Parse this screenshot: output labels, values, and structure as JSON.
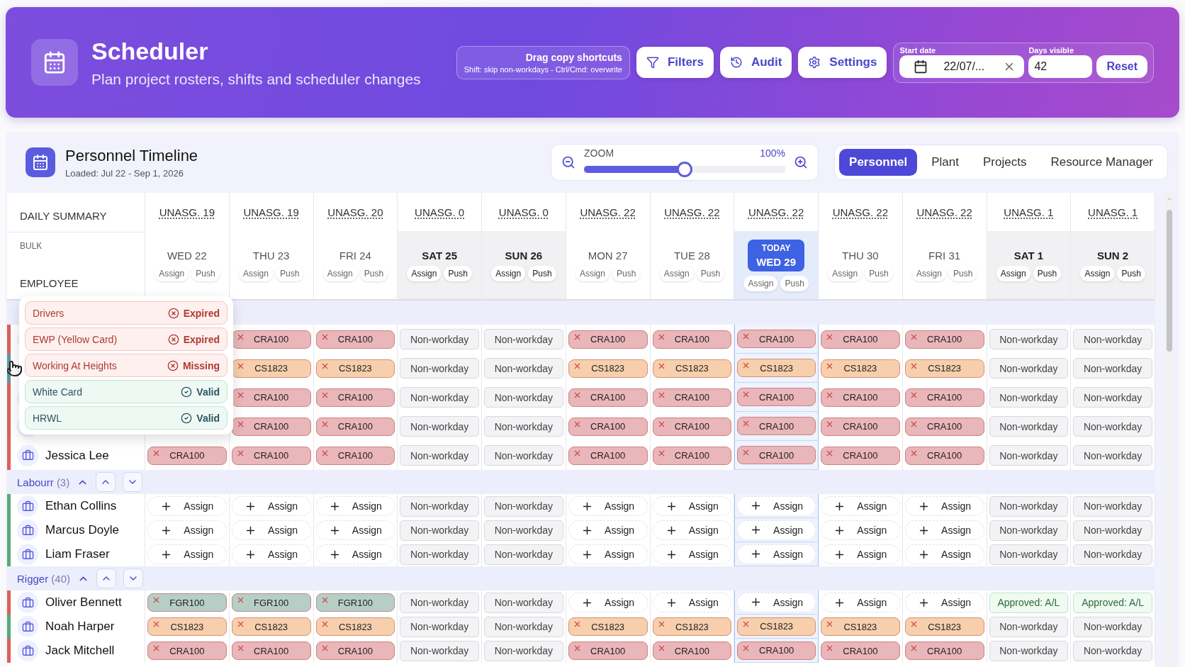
{
  "header": {
    "title": "Scheduler",
    "subtitle": "Plan project rosters, shifts and scheduler changes",
    "shortcuts": {
      "title": "Drag copy shortcuts",
      "detail": "Shift: skip non-workdays - Ctrl/Cmd: overwrite"
    },
    "buttons": [
      {
        "kind": "filter",
        "label": "Filters"
      },
      {
        "kind": "audit",
        "label": "Audit"
      },
      {
        "kind": "settings",
        "label": "Settings"
      }
    ],
    "start_date": {
      "label": "Start date",
      "value": "22/07/..."
    },
    "days_visible": {
      "label": "Days visible",
      "value": "42"
    },
    "reset": "Reset"
  },
  "timeline": {
    "title": "Personnel Timeline",
    "loaded": "Loaded: Jul 22 - Sep 1, 2026",
    "zoom": {
      "label": "ZOOM",
      "level": 0.5,
      "reading": "100%"
    },
    "tabs": [
      {
        "label": "Personnel",
        "selected": true
      },
      {
        "label": "Plant",
        "selected": false
      },
      {
        "label": "Projects",
        "selected": false
      },
      {
        "label": "Resource Manager",
        "selected": false
      }
    ]
  },
  "grid": {
    "summary_label": "DAILY SUMMARY",
    "bulk_label": "BULK",
    "employee_label": "EMPLOYEE",
    "days": [
      {
        "summary": "UNASG. 19",
        "label": "WED 22",
        "kind": "workday",
        "buttons": [
          "Assign",
          "Push"
        ]
      },
      {
        "summary": "UNASG. 19",
        "label": "THU 23",
        "kind": "workday",
        "buttons": [
          "Assign",
          "Push"
        ]
      },
      {
        "summary": "UNASG. 20",
        "label": "FRI 24",
        "kind": "workday",
        "buttons": [
          "Assign",
          "Push"
        ]
      },
      {
        "summary": "UNASG. 0",
        "label": "SAT 25",
        "kind": "weekend",
        "buttons": [
          "Assign",
          "Push"
        ]
      },
      {
        "summary": "UNASG. 0",
        "label": "SUN 26",
        "kind": "weekend",
        "buttons": [
          "Assign",
          "Push"
        ]
      },
      {
        "summary": "UNASG. 22",
        "label": "MON 27",
        "kind": "workday",
        "buttons": [
          "Assign",
          "Push"
        ]
      },
      {
        "summary": "UNASG. 22",
        "label": "TUE 28",
        "kind": "workday",
        "buttons": [
          "Assign",
          "Push"
        ]
      },
      {
        "summary": "UNASG. 22",
        "label": "WED 29",
        "kind": "today",
        "badge": "TODAY",
        "buttons": [
          "Assign",
          "Push"
        ]
      },
      {
        "summary": "UNASG. 22",
        "label": "THU 30",
        "kind": "workday",
        "buttons": [
          "Assign",
          "Push"
        ]
      },
      {
        "summary": "UNASG. 22",
        "label": "FRI 31",
        "kind": "workday",
        "buttons": [
          "Assign",
          "Push"
        ]
      },
      {
        "summary": "UNASG. 1",
        "label": "SAT 1",
        "kind": "weekend",
        "buttons": [
          "Assign",
          "Push"
        ]
      },
      {
        "summary": "UNASG. 1",
        "label": "SUN 2",
        "kind": "weekend",
        "buttons": [
          "Assign",
          "Push"
        ]
      }
    ],
    "groups": [
      {
        "rows": [
          {
            "color": "#d9605a",
            "cells": [
              null,
              {
                "kind": "project",
                "code": "CRA100",
                "color": "#e9b6ba"
              },
              {
                "kind": "project",
                "code": "CRA100",
                "color": "#e9b6ba"
              },
              {
                "kind": "nonworkday",
                "text": "Non-workday"
              },
              {
                "kind": "nonworkday",
                "text": "Non-workday"
              },
              {
                "kind": "project",
                "code": "CRA100",
                "color": "#e9b6ba"
              },
              {
                "kind": "project",
                "code": "CRA100",
                "color": "#e9b6ba"
              },
              {
                "kind": "project",
                "code": "CRA100",
                "color": "#e9b6ba"
              },
              {
                "kind": "project",
                "code": "CRA100",
                "color": "#e9b6ba"
              },
              {
                "kind": "project",
                "code": "CRA100",
                "color": "#e9b6ba"
              },
              {
                "kind": "nonworkday",
                "text": "Non-workday"
              },
              {
                "kind": "nonworkday",
                "text": "Non-workday"
              }
            ]
          },
          {
            "color": "#5a9a9a",
            "cells": [
              null,
              {
                "kind": "project",
                "code": "CS1823",
                "color": "#f7cfac"
              },
              {
                "kind": "project",
                "code": "CS1823",
                "color": "#f7cfac"
              },
              {
                "kind": "nonworkday",
                "text": "Non-workday"
              },
              {
                "kind": "nonworkday",
                "text": "Non-workday"
              },
              {
                "kind": "project",
                "code": "CS1823",
                "color": "#f7cfac"
              },
              {
                "kind": "project",
                "code": "CS1823",
                "color": "#f7cfac"
              },
              {
                "kind": "project",
                "code": "CS1823",
                "color": "#f7cfac"
              },
              {
                "kind": "project",
                "code": "CS1823",
                "color": "#f7cfac"
              },
              {
                "kind": "project",
                "code": "CS1823",
                "color": "#f7cfac"
              },
              {
                "kind": "nonworkday",
                "text": "Non-workday"
              },
              {
                "kind": "nonworkday",
                "text": "Non-workday"
              }
            ]
          },
          {
            "color": "#d9605a",
            "cells": [
              null,
              {
                "kind": "project",
                "code": "CRA100",
                "color": "#e9b6ba"
              },
              {
                "kind": "project",
                "code": "CRA100",
                "color": "#e9b6ba"
              },
              {
                "kind": "nonworkday",
                "text": "Non-workday"
              },
              {
                "kind": "nonworkday",
                "text": "Non-workday"
              },
              {
                "kind": "project",
                "code": "CRA100",
                "color": "#e9b6ba"
              },
              {
                "kind": "project",
                "code": "CRA100",
                "color": "#e9b6ba"
              },
              {
                "kind": "project",
                "code": "CRA100",
                "color": "#e9b6ba"
              },
              {
                "kind": "project",
                "code": "CRA100",
                "color": "#e9b6ba"
              },
              {
                "kind": "project",
                "code": "CRA100",
                "color": "#e9b6ba"
              },
              {
                "kind": "nonworkday",
                "text": "Non-workday"
              },
              {
                "kind": "nonworkday",
                "text": "Non-workday"
              }
            ]
          },
          {
            "color": "#d9605a",
            "cells": [
              null,
              {
                "kind": "project",
                "code": "CRA100",
                "color": "#e9b6ba"
              },
              {
                "kind": "project",
                "code": "CRA100",
                "color": "#e9b6ba"
              },
              {
                "kind": "nonworkday",
                "text": "Non-workday"
              },
              {
                "kind": "nonworkday",
                "text": "Non-workday"
              },
              {
                "kind": "project",
                "code": "CRA100",
                "color": "#e9b6ba"
              },
              {
                "kind": "project",
                "code": "CRA100",
                "color": "#e9b6ba"
              },
              {
                "kind": "project",
                "code": "CRA100",
                "color": "#e9b6ba"
              },
              {
                "kind": "project",
                "code": "CRA100",
                "color": "#e9b6ba"
              },
              {
                "kind": "project",
                "code": "CRA100",
                "color": "#e9b6ba"
              },
              {
                "kind": "nonworkday",
                "text": "Non-workday"
              },
              {
                "kind": "nonworkday",
                "text": "Non-workday"
              }
            ]
          },
          {
            "name": "Jessica Lee",
            "color": "#d9605a",
            "cells": [
              {
                "kind": "project",
                "code": "CRA100",
                "color": "#e9b6ba"
              },
              {
                "kind": "project",
                "code": "CRA100",
                "color": "#e9b6ba"
              },
              {
                "kind": "project",
                "code": "CRA100",
                "color": "#e9b6ba"
              },
              {
                "kind": "nonworkday",
                "text": "Non-workday"
              },
              {
                "kind": "nonworkday",
                "text": "Non-workday"
              },
              {
                "kind": "project",
                "code": "CRA100",
                "color": "#e9b6ba"
              },
              {
                "kind": "project",
                "code": "CRA100",
                "color": "#e9b6ba"
              },
              {
                "kind": "project",
                "code": "CRA100",
                "color": "#e9b6ba"
              },
              {
                "kind": "project",
                "code": "CRA100",
                "color": "#e9b6ba"
              },
              {
                "kind": "project",
                "code": "CRA100",
                "color": "#e9b6ba"
              },
              {
                "kind": "nonworkday",
                "text": "Non-workday"
              },
              {
                "kind": "nonworkday",
                "text": "Non-workday"
              }
            ]
          }
        ]
      },
      {
        "name": "Labourr",
        "count": "(3)",
        "expanded": true,
        "rows": [
          {
            "name": "Ethan Collins",
            "color": "#5aa978",
            "cells": [
              {
                "kind": "assign",
                "text": "Assign"
              },
              {
                "kind": "assign",
                "text": "Assign"
              },
              {
                "kind": "assign",
                "text": "Assign"
              },
              {
                "kind": "nonworkday",
                "text": "Non-workday"
              },
              {
                "kind": "nonworkday",
                "text": "Non-workday"
              },
              {
                "kind": "assign",
                "text": "Assign"
              },
              {
                "kind": "assign",
                "text": "Assign"
              },
              {
                "kind": "assign",
                "text": "Assign"
              },
              {
                "kind": "assign",
                "text": "Assign"
              },
              {
                "kind": "assign",
                "text": "Assign"
              },
              {
                "kind": "nonworkday",
                "text": "Non-workday"
              },
              {
                "kind": "nonworkday",
                "text": "Non-workday"
              }
            ]
          },
          {
            "name": "Marcus Doyle",
            "color": "#5aa978",
            "cells": [
              {
                "kind": "assign",
                "text": "Assign"
              },
              {
                "kind": "assign",
                "text": "Assign"
              },
              {
                "kind": "assign",
                "text": "Assign"
              },
              {
                "kind": "nonworkday",
                "text": "Non-workday"
              },
              {
                "kind": "nonworkday",
                "text": "Non-workday"
              },
              {
                "kind": "assign",
                "text": "Assign"
              },
              {
                "kind": "assign",
                "text": "Assign"
              },
              {
                "kind": "assign",
                "text": "Assign"
              },
              {
                "kind": "assign",
                "text": "Assign"
              },
              {
                "kind": "assign",
                "text": "Assign"
              },
              {
                "kind": "nonworkday",
                "text": "Non-workday"
              },
              {
                "kind": "nonworkday",
                "text": "Non-workday"
              }
            ]
          },
          {
            "name": "Liam Fraser",
            "color": "#5aa978",
            "cells": [
              {
                "kind": "assign",
                "text": "Assign"
              },
              {
                "kind": "assign",
                "text": "Assign"
              },
              {
                "kind": "assign",
                "text": "Assign"
              },
              {
                "kind": "nonworkday",
                "text": "Non-workday"
              },
              {
                "kind": "nonworkday",
                "text": "Non-workday"
              },
              {
                "kind": "assign",
                "text": "Assign"
              },
              {
                "kind": "assign",
                "text": "Assign"
              },
              {
                "kind": "assign",
                "text": "Assign"
              },
              {
                "kind": "assign",
                "text": "Assign"
              },
              {
                "kind": "assign",
                "text": "Assign"
              },
              {
                "kind": "nonworkday",
                "text": "Non-workday"
              },
              {
                "kind": "nonworkday",
                "text": "Non-workday"
              }
            ]
          }
        ]
      },
      {
        "name": "Rigger",
        "count": "(40)",
        "expanded": true,
        "rows": [
          {
            "name": "Oliver Bennett",
            "color": "#d9605a",
            "cells": [
              {
                "kind": "project",
                "code": "FGR100",
                "color": "#b7cec7"
              },
              {
                "kind": "project",
                "code": "FGR100",
                "color": "#b7cec7"
              },
              {
                "kind": "project",
                "code": "FGR100",
                "color": "#b7cec7"
              },
              {
                "kind": "nonworkday",
                "text": "Non-workday"
              },
              {
                "kind": "nonworkday",
                "text": "Non-workday"
              },
              {
                "kind": "assign",
                "text": "Assign"
              },
              {
                "kind": "assign",
                "text": "Assign"
              },
              {
                "kind": "assign",
                "text": "Assign"
              },
              {
                "kind": "assign",
                "text": "Assign"
              },
              {
                "kind": "assign",
                "text": "Assign"
              },
              {
                "kind": "leave",
                "text": "Approved: A/L"
              },
              {
                "kind": "leave",
                "text": "Approved: A/L"
              }
            ]
          },
          {
            "name": "Noah Harper",
            "color": "#5aa978",
            "cells": [
              {
                "kind": "project",
                "code": "CS1823",
                "color": "#f7cfac"
              },
              {
                "kind": "project",
                "code": "CS1823",
                "color": "#f7cfac"
              },
              {
                "kind": "project",
                "code": "CS1823",
                "color": "#f7cfac"
              },
              {
                "kind": "nonworkday",
                "text": "Non-workday"
              },
              {
                "kind": "nonworkday",
                "text": "Non-workday"
              },
              {
                "kind": "project",
                "code": "CS1823",
                "color": "#f7cfac"
              },
              {
                "kind": "project",
                "code": "CS1823",
                "color": "#f7cfac"
              },
              {
                "kind": "project",
                "code": "CS1823",
                "color": "#f7cfac"
              },
              {
                "kind": "project",
                "code": "CS1823",
                "color": "#f7cfac"
              },
              {
                "kind": "project",
                "code": "CS1823",
                "color": "#f7cfac"
              },
              {
                "kind": "nonworkday",
                "text": "Non-workday"
              },
              {
                "kind": "nonworkday",
                "text": "Non-workday"
              }
            ]
          },
          {
            "name": "Jack Mitchell",
            "color": "#d9605a",
            "cells": [
              {
                "kind": "project",
                "code": "CRA100",
                "color": "#e9b6ba"
              },
              {
                "kind": "project",
                "code": "CRA100",
                "color": "#e9b6ba"
              },
              {
                "kind": "project",
                "code": "CRA100",
                "color": "#e9b6ba"
              },
              {
                "kind": "nonworkday",
                "text": "Non-workday"
              },
              {
                "kind": "nonworkday",
                "text": "Non-workday"
              },
              {
                "kind": "project",
                "code": "CRA100",
                "color": "#e9b6ba"
              },
              {
                "kind": "project",
                "code": "CRA100",
                "color": "#e9b6ba"
              },
              {
                "kind": "project",
                "code": "CRA100",
                "color": "#e9b6ba"
              },
              {
                "kind": "project",
                "code": "CRA100",
                "color": "#e9b6ba"
              },
              {
                "kind": "project",
                "code": "CRA100",
                "color": "#e9b6ba"
              },
              {
                "kind": "nonworkday",
                "text": "Non-workday"
              },
              {
                "kind": "nonworkday",
                "text": "Non-workday"
              }
            ]
          }
        ]
      }
    ]
  },
  "popover": {
    "items": [
      {
        "label": "Drivers",
        "status": "Expired",
        "valid": false
      },
      {
        "label": "EWP (Yellow Card)",
        "status": "Expired",
        "valid": false
      },
      {
        "label": "Working At Heights",
        "status": "Missing",
        "valid": false
      },
      {
        "label": "White Card",
        "status": "Valid",
        "valid": true
      },
      {
        "label": "HRWL",
        "status": "Valid",
        "valid": true
      }
    ]
  }
}
